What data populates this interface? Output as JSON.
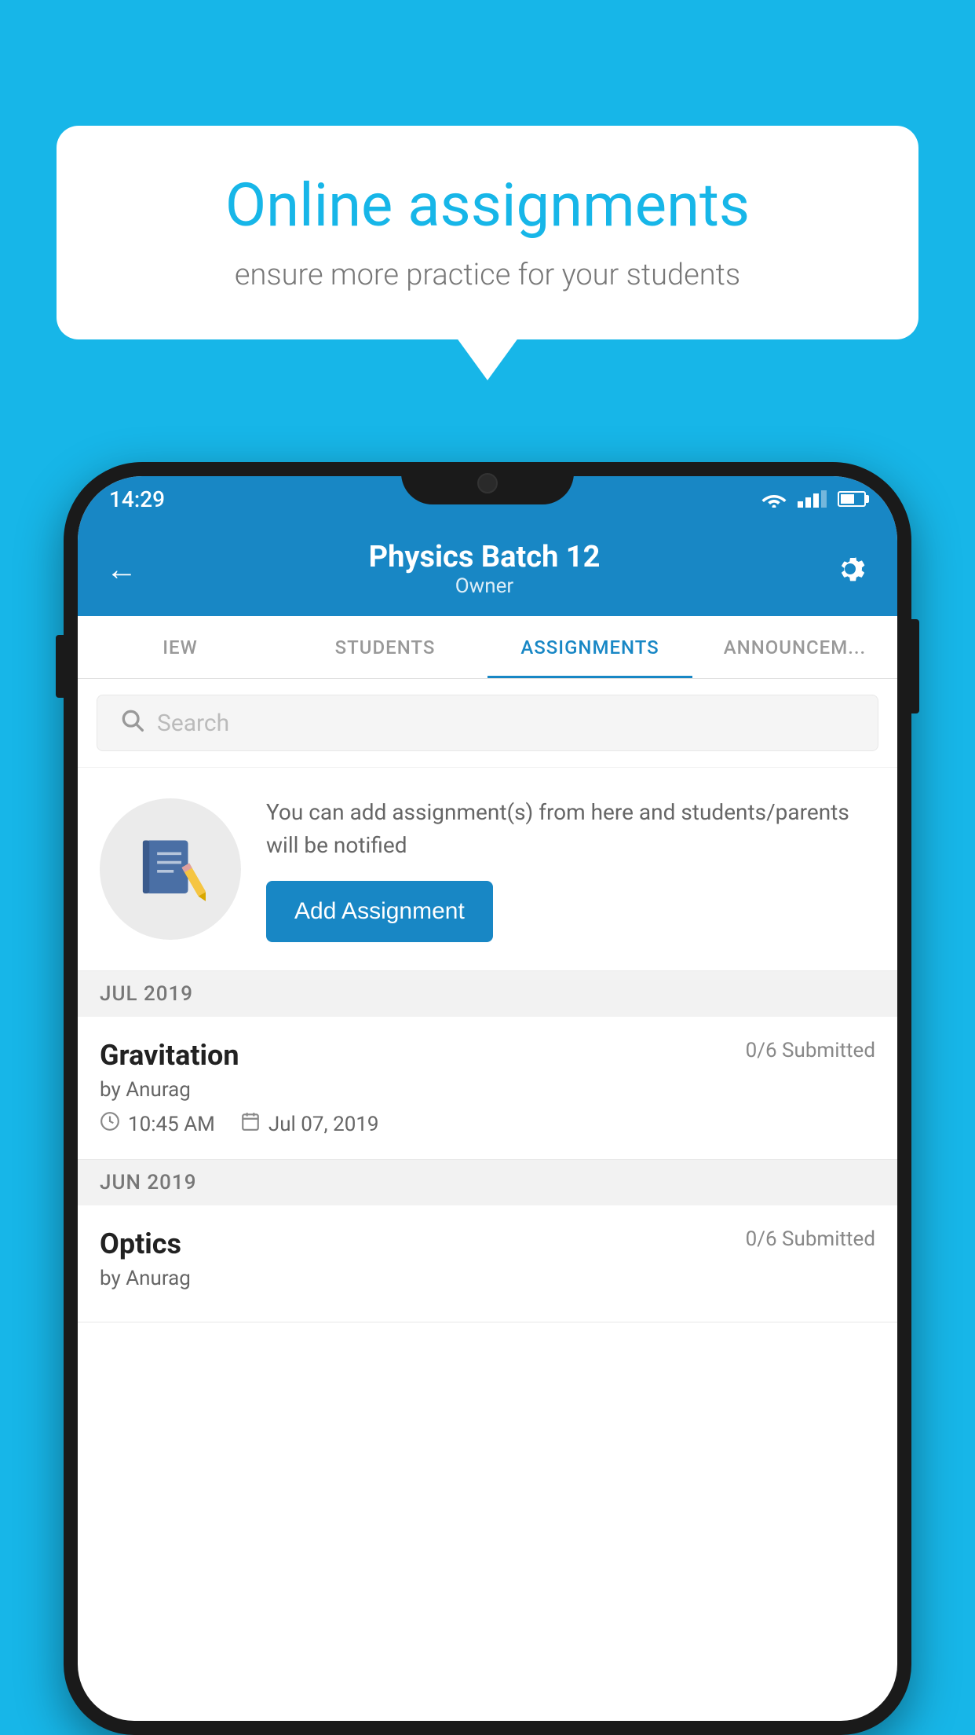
{
  "background_color": "#17b6e8",
  "speech_bubble": {
    "title": "Online assignments",
    "subtitle": "ensure more practice for your students"
  },
  "status_bar": {
    "time": "14:29",
    "wifi": true,
    "signal": true,
    "battery": true
  },
  "app_header": {
    "title": "Physics Batch 12",
    "subtitle": "Owner",
    "back_label": "←"
  },
  "tabs": [
    {
      "label": "IEW",
      "active": false
    },
    {
      "label": "STUDENTS",
      "active": false
    },
    {
      "label": "ASSIGNMENTS",
      "active": true
    },
    {
      "label": "ANNOUNCEM...",
      "active": false
    }
  ],
  "search": {
    "placeholder": "Search"
  },
  "promo": {
    "text": "You can add assignment(s) from here and students/parents will be notified",
    "button_label": "Add Assignment"
  },
  "sections": [
    {
      "label": "JUL 2019",
      "assignments": [
        {
          "name": "Gravitation",
          "submitted": "0/6 Submitted",
          "by": "by Anurag",
          "time": "10:45 AM",
          "date": "Jul 07, 2019"
        }
      ]
    },
    {
      "label": "JUN 2019",
      "assignments": [
        {
          "name": "Optics",
          "submitted": "0/6 Submitted",
          "by": "by Anurag",
          "time": "",
          "date": ""
        }
      ]
    }
  ]
}
